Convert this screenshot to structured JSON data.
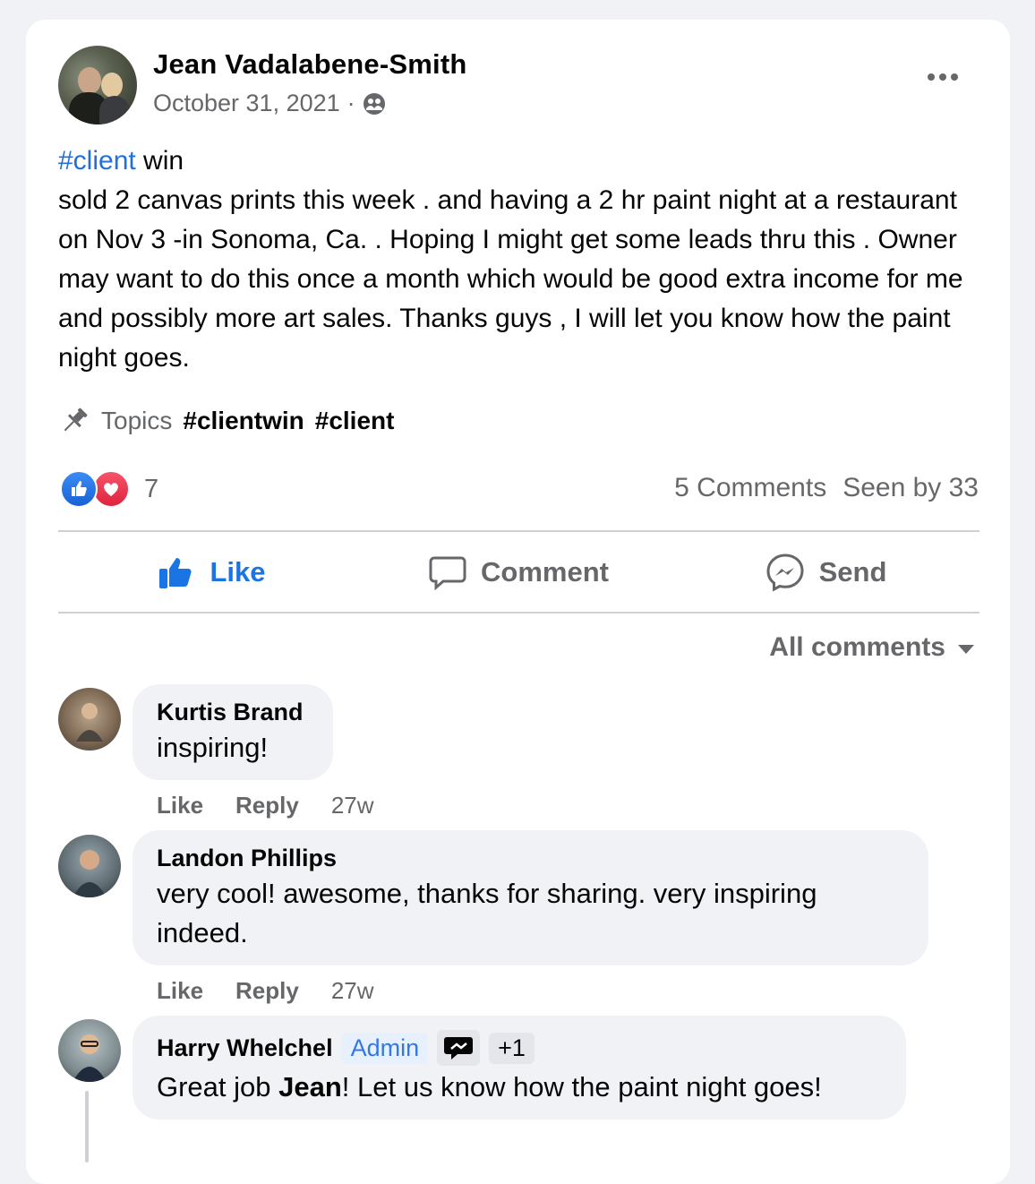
{
  "post": {
    "author": "Jean Vadalabene-Smith",
    "date": "October 31, 2021",
    "separator": "·",
    "audience_icon": "group-icon",
    "hashtag": "#client",
    "first_line_rest": " win",
    "body": "sold 2 canvas prints this week . and having a 2 hr paint night  at a restaurant on Nov 3 -in Sonoma, Ca. . Hoping I might get some leads thru this . Owner may want to do this once a month which would be  good extra income for me and possibly more  art sales. Thanks guys , I will let you know how the paint night goes.",
    "topics_label": "Topics",
    "topics": [
      "#clientwin",
      "#client"
    ],
    "reaction_count": "7",
    "comments_count": "5 Comments",
    "seen_by": "Seen by 33"
  },
  "actions": {
    "like": "Like",
    "comment": "Comment",
    "send": "Send"
  },
  "sort_label": "All comments",
  "comments": [
    {
      "name": "Kurtis Brand",
      "text": "inspiring!",
      "like": "Like",
      "reply": "Reply",
      "time": "27w"
    },
    {
      "name": "Landon Phillips",
      "text": "very cool! awesome, thanks for sharing. very inspiring indeed.",
      "like": "Like",
      "reply": "Reply",
      "time": "27w"
    },
    {
      "name": "Harry Whelchel",
      "badge": "Admin",
      "badge_extra": "+1",
      "text_before": "Great job ",
      "text_bold": "Jean",
      "text_after": "! Let us know how the paint night goes!"
    }
  ],
  "colors": {
    "accent": "#1b74e4",
    "hashtag": "#216fdb",
    "secondary_text": "#65676b",
    "bubble": "#f0f2f5"
  }
}
